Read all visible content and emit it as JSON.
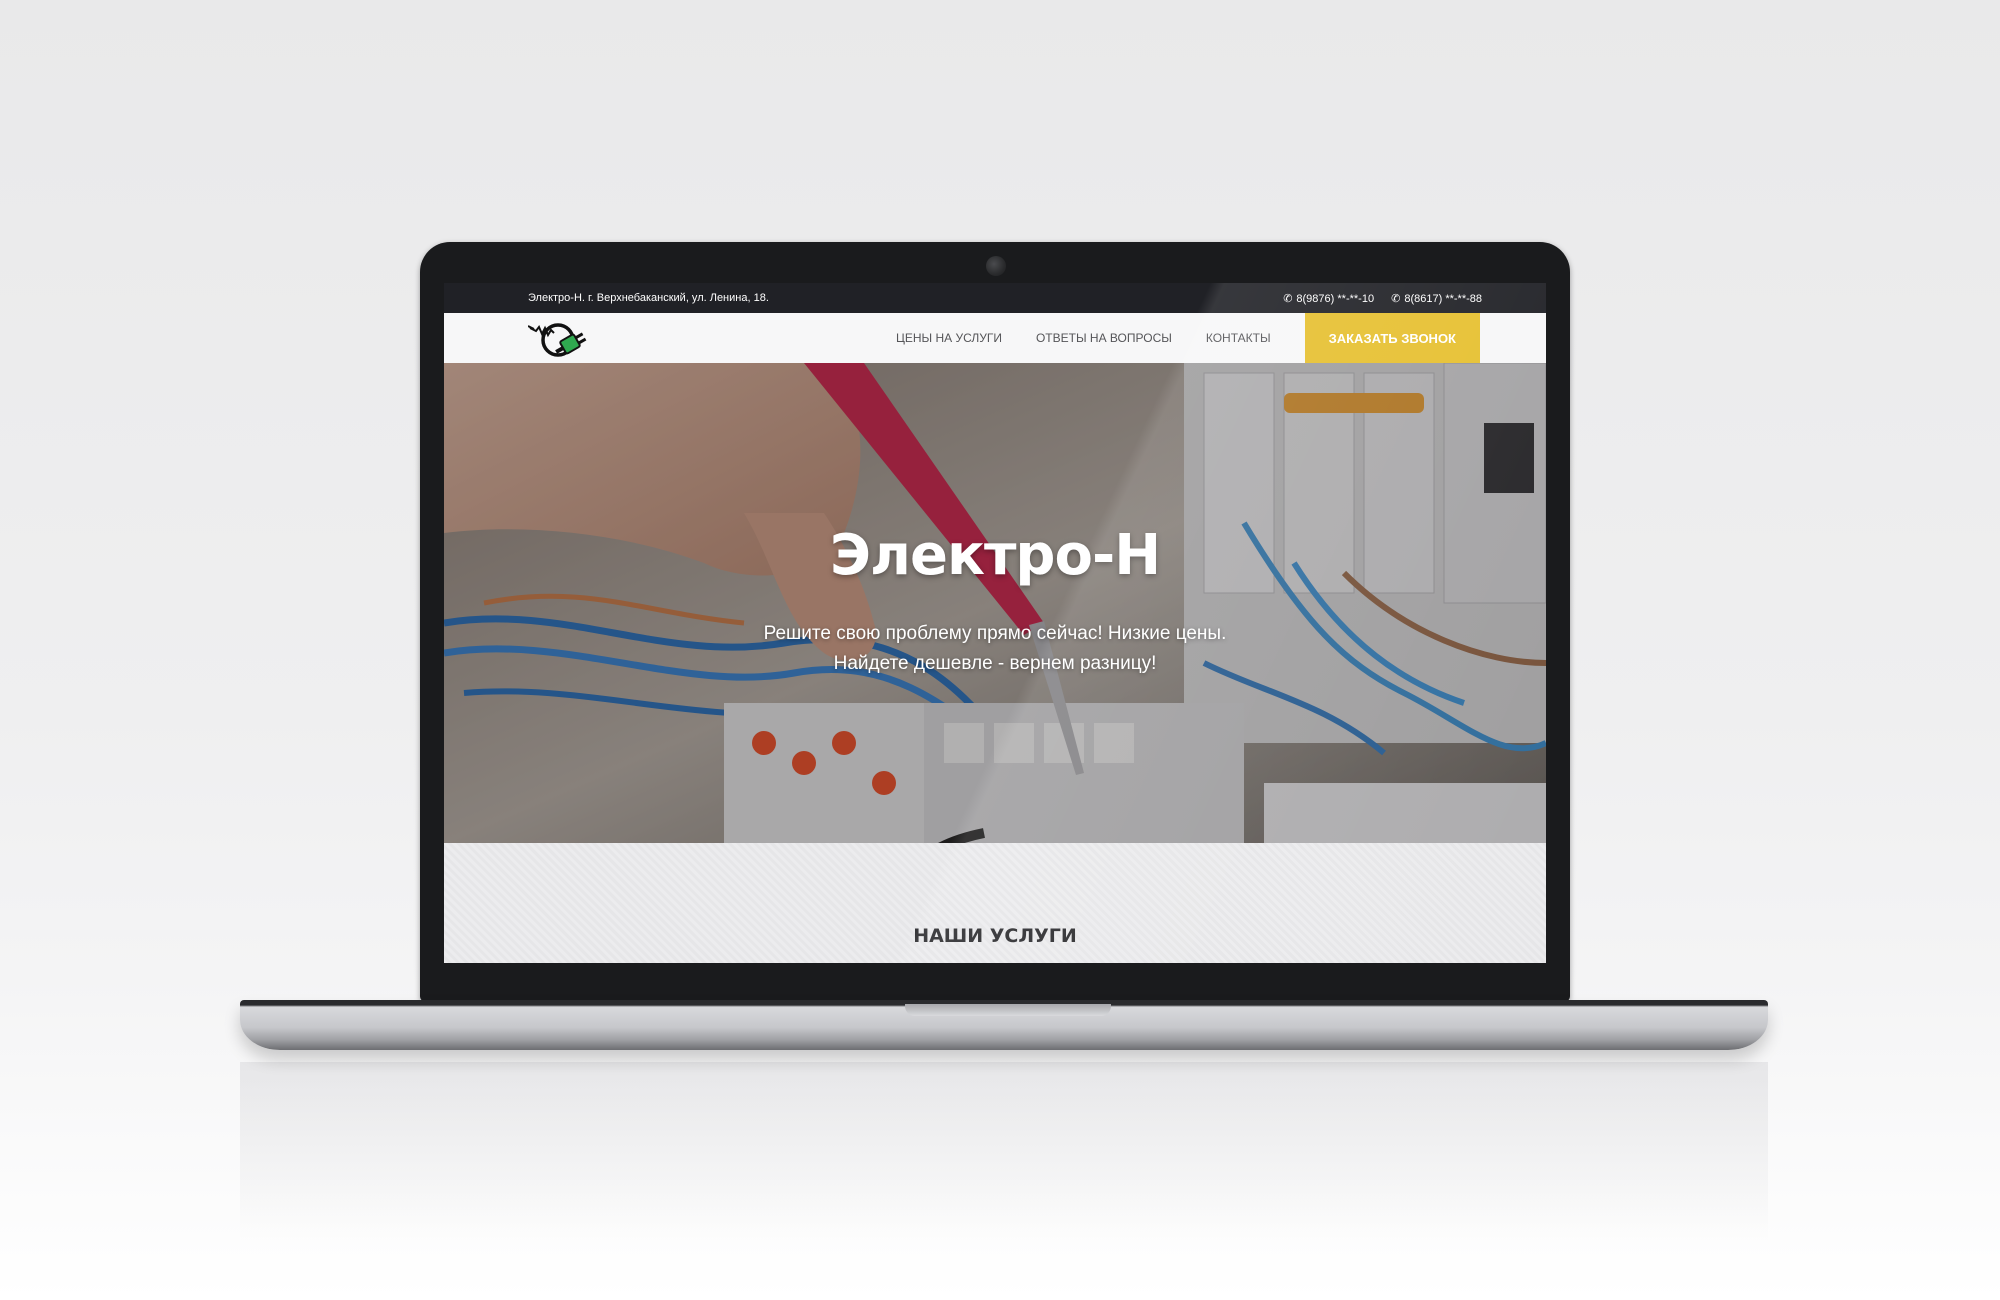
{
  "topbar": {
    "address": "Электро-Н. г. Верхнебаканский, ул. Ленина, 18.",
    "phones": [
      {
        "icon": "phone-icon",
        "number": "8(9876) **-**-10"
      },
      {
        "icon": "phone-icon",
        "number": "8(8617) **-**-88"
      }
    ]
  },
  "navbar": {
    "logo": "electric-plug-logo",
    "links": [
      {
        "label": "ЦЕНЫ НА УСЛУГИ"
      },
      {
        "label": "ОТВЕТЫ НА ВОПРОСЫ"
      },
      {
        "label": "КОНТАКТЫ"
      }
    ],
    "cta_label": "ЗАКАЗАТЬ ЗВОНОК"
  },
  "hero": {
    "title": "Электро-Н",
    "subtitle_line1": "Решите свою проблему прямо сейчас! Низкие цены.",
    "subtitle_line2": "Найдете дешевле - вернем разницу!"
  },
  "services": {
    "title": "НАШИ УСЛУГИ"
  },
  "colors": {
    "topbar_bg": "#202126",
    "navbar_bg": "#f7f7f8",
    "cta_bg": "#e6c030",
    "cta_text": "#ffffff",
    "nav_text": "#555558",
    "logo_accent": "#2fa84f"
  }
}
